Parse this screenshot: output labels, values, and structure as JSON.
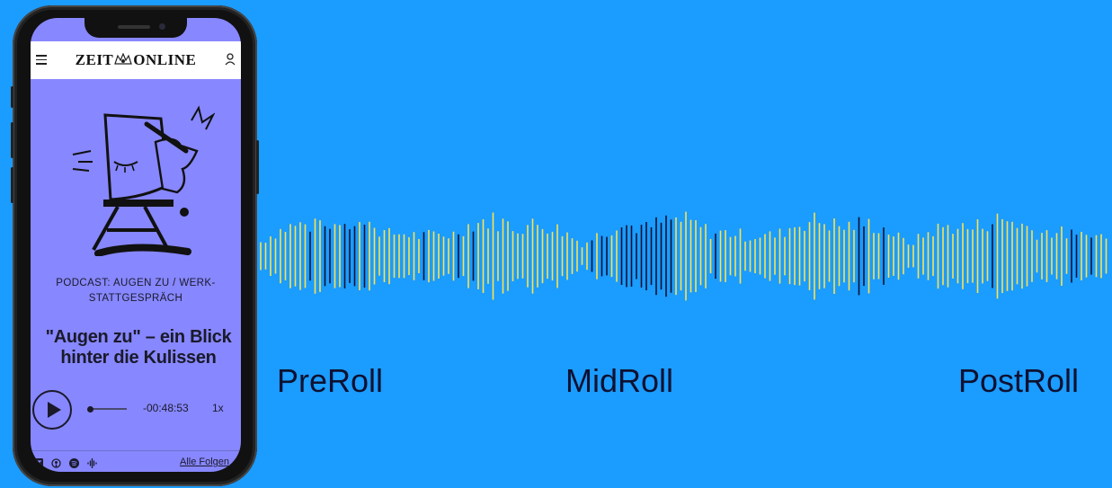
{
  "colors": {
    "background": "#1b9cff",
    "screen": "#8787ff",
    "wave_yellow": "#ffe34a",
    "wave_dark": "#0e1130"
  },
  "app": {
    "logo_left": "ZEIT",
    "logo_right": "ONLINE"
  },
  "episode": {
    "category_line1": "PODCAST: AUGEN ZU / WERK-",
    "category_line2": "STATTGESPRÄCH",
    "title_line1": "\"Augen zu\" – ein Blick",
    "title_line2": "hinter die Kulissen"
  },
  "player": {
    "remaining_time": "-00:48:53",
    "speed": "1x",
    "progress": 0.0
  },
  "footer": {
    "icons": [
      "zeit-icon",
      "apple-podcasts-icon",
      "spotify-icon",
      "google-podcasts-icon"
    ],
    "all_episodes_label": "Alle Folgen"
  },
  "labels": {
    "preroll": "PreRoll",
    "midroll": "MidRoll",
    "postroll": "PostRoll"
  }
}
